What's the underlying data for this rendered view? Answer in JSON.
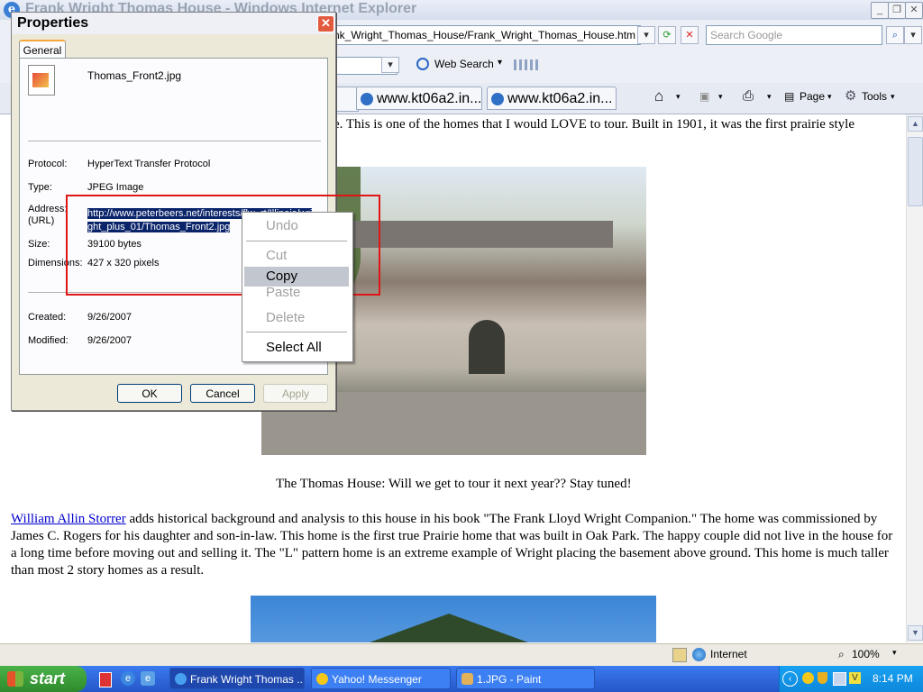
{
  "ie": {
    "title": "Frank Wright Thomas House - Windows Internet Explorer",
    "address": "nk_Wright_Thomas_House/Frank_Wright_Thomas_House.htm",
    "search_placeholder": "Search Google",
    "web_search": "Web Search",
    "tabs": [
      "www.kt06a2.in...",
      "www.kt06a2.in..."
    ],
    "page_label": "Page",
    "tools_label": "Tools"
  },
  "page": {
    "intro": "e.  This is one of the homes that I would LOVE to tour.   Built in 1901, it was the first prairie style",
    "caption": "The Thomas House: Will we get to tour it next year?? Stay tuned!",
    "link": "William Allin Storrer",
    "para_line1": " adds historical background and analysis to this house in his book \"The Frank Lloyd Wright Companion.\" The home was commissioned by",
    "para_line2": "James C. Rogers for his daughter and son-in-law.  This home is the first true Prairie home that was built in Oak Park.  The happy couple did not live in the house for",
    "para_line3": "a long time before moving out and selling it.  The \"L\" pattern home is an extreme example of Wright placing the basement above ground.  This home is much taller",
    "para_line4": "than most 2 story homes as a result."
  },
  "status": {
    "zone": "Internet",
    "zoom": "100%"
  },
  "taskbar": {
    "start": "start",
    "tasks": [
      "Frank Wright Thomas ...",
      "Yahoo! Messenger",
      "1.JPG - Paint"
    ],
    "clock": "8:14 PM"
  },
  "dialog": {
    "title": "Properties",
    "tab": "General",
    "filename": "Thomas_Front2.jpg",
    "protocol_label": "Protocol:",
    "protocol": "HyperText Transfer Protocol",
    "type_label": "Type:",
    "type": "JPEG Image",
    "address_label": "Address:",
    "url_label": "(URL)",
    "url_line1": "http://www.peterbeers.net/interests/flw_rt/Illinois/wri",
    "url_line2": "ght_plus_01/Thomas_Front2.jpg",
    "size_label": "Size:",
    "size": "39100 bytes",
    "dim_label": "Dimensions:",
    "dimensions": "427  x  320  pixels",
    "created_label": "Created:",
    "created": "9/26/2007",
    "modified_label": "Modified:",
    "modified": "9/26/2007",
    "ok": "OK",
    "cancel": "Cancel",
    "apply": "Apply"
  },
  "context_menu": {
    "undo": "Undo",
    "cut": "Cut",
    "copy": "Copy",
    "paste": "Paste",
    "delete": "Delete",
    "select_all": "Select All"
  },
  "colors": {
    "highlight_box": "#e01515",
    "selection": "#0a246a",
    "link": "#0000cc"
  }
}
